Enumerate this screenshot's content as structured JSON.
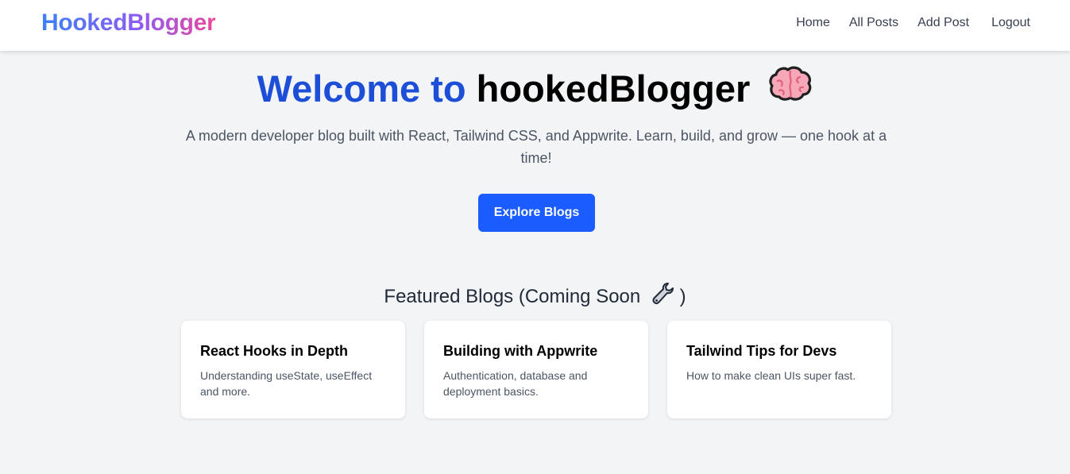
{
  "nav": {
    "logo": "HookedBlogger",
    "links": [
      "Home",
      "All Posts",
      "Add Post",
      "Logout"
    ]
  },
  "hero": {
    "title_accent": "Welcome to",
    "title_rest": "hookedBlogger",
    "title_icon": "brain-icon",
    "subtitle": "A modern developer blog built with React, Tailwind CSS, and Appwrite. Learn, build, and grow — one hook at a time!",
    "button_label": "Explore Blogs"
  },
  "featured": {
    "title_prefix": "Featured Blogs (Coming Soon",
    "title_icon": "wrench-icon",
    "title_suffix": ")",
    "cards": [
      {
        "title": "React Hooks in Depth",
        "description": "Understanding useState, useEffect and more."
      },
      {
        "title": "Building with Appwrite",
        "description": "Authentication, database and deployment basics."
      },
      {
        "title": "Tailwind Tips for Devs",
        "description": "How to make clean UIs super fast."
      }
    ]
  },
  "colors": {
    "accent": "#1d4ed8",
    "button": "#1a5cff",
    "background": "#f3f4f6",
    "logo_gradient": [
      "#3b82f6",
      "#8b5cf6",
      "#ec4899"
    ]
  }
}
